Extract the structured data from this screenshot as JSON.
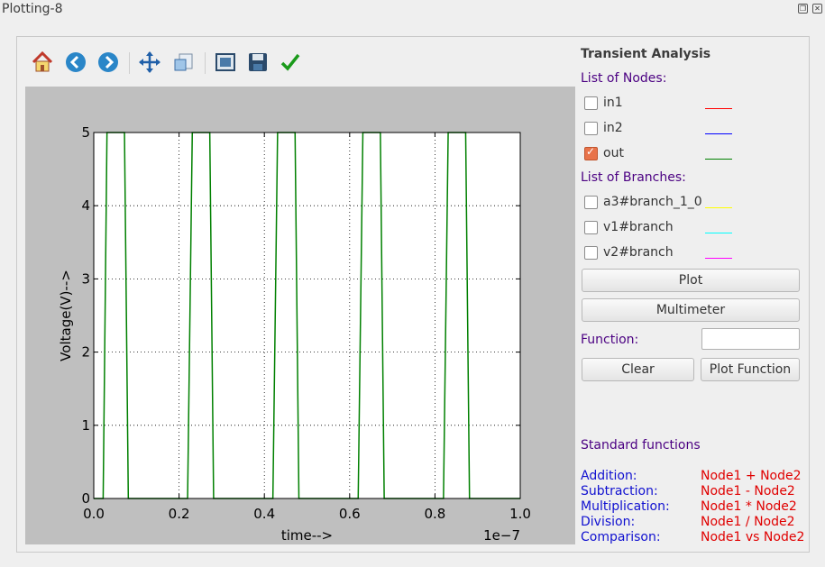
{
  "window": {
    "title": "Plotting-8"
  },
  "toolbar": {
    "icons": [
      "home-icon",
      "back-icon",
      "forward-icon",
      "pan-icon",
      "zoom-icon",
      "configure-subplots-icon",
      "save-icon",
      "edit-icon"
    ]
  },
  "chart_data": {
    "type": "line",
    "xlabel": "time-->",
    "ylabel": "Voltage(V)-->",
    "x_offset_label": "1e−7",
    "xlim": [
      0.0,
      1.0
    ],
    "ylim": [
      0,
      5
    ],
    "xticks": [
      "0.0",
      "0.2",
      "0.4",
      "0.6",
      "0.8",
      "1.0"
    ],
    "yticks": [
      "0",
      "1",
      "2",
      "3",
      "4",
      "5"
    ],
    "grid": true,
    "series": [
      {
        "color": "#008000",
        "x": [
          0.0,
          0.022,
          0.031,
          0.072,
          0.081,
          0.22,
          0.231,
          0.272,
          0.281,
          0.42,
          0.431,
          0.472,
          0.481,
          0.62,
          0.631,
          0.672,
          0.681,
          0.82,
          0.831,
          0.872,
          0.881,
          1.0
        ],
        "y": [
          0,
          0,
          5,
          5,
          0,
          0,
          5,
          5,
          0,
          0,
          5,
          5,
          0,
          0,
          5,
          5,
          0,
          0,
          5,
          5,
          0,
          0
        ]
      }
    ]
  },
  "panel": {
    "title": "Transient Analysis",
    "nodes_heading": "List of Nodes:",
    "nodes": [
      {
        "label": "in1",
        "checked": false,
        "color": "#ff0000"
      },
      {
        "label": "in2",
        "checked": false,
        "color": "#0000ff"
      },
      {
        "label": "out",
        "checked": true,
        "color": "#008000"
      }
    ],
    "branches_heading": "List of Branches:",
    "branches": [
      {
        "label": "a3#branch_1_0",
        "checked": false,
        "color": "#ffff00"
      },
      {
        "label": "v1#branch",
        "checked": false,
        "color": "#00ffff"
      },
      {
        "label": "v2#branch",
        "checked": false,
        "color": "#ff00ff"
      }
    ],
    "plot_button": "Plot",
    "multimeter_button": "Multimeter",
    "function_label": "Function:",
    "function_value": "",
    "clear_button": "Clear",
    "plot_function_button": "Plot Function",
    "standard_heading": "Standard functions",
    "functions": [
      {
        "name": "Addition:",
        "expr": "Node1 + Node2"
      },
      {
        "name": "Subtraction:",
        "expr": "Node1 - Node2"
      },
      {
        "name": "Multiplication:",
        "expr": "Node1 * Node2"
      },
      {
        "name": "Division:",
        "expr": "Node1 / Node2"
      },
      {
        "name": "Comparison:",
        "expr": "Node1 vs Node2"
      }
    ]
  }
}
